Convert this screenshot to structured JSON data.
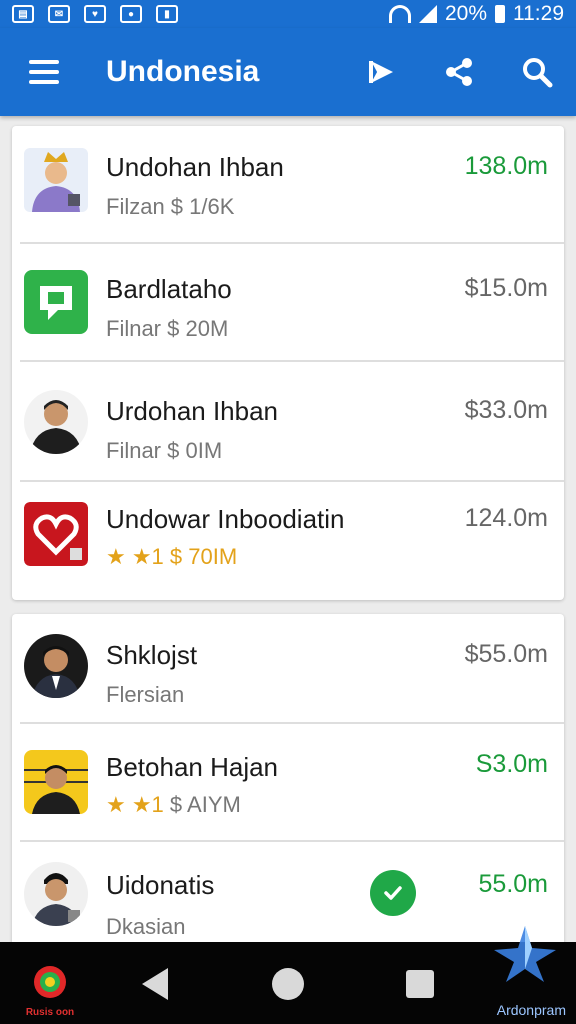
{
  "status_bar": {
    "battery": "20%",
    "time": "11:29"
  },
  "app_bar": {
    "title": "Undonesia"
  },
  "groups": [
    {
      "rows": [
        {
          "title": "Undohan Ihban",
          "subtitle": "Filzan $ 1/6K",
          "amount": "138.0m",
          "amount_color": "#1a9a3a",
          "avatar": "crowned-man-avatar",
          "stars": ""
        },
        {
          "title": "Bardlataho",
          "subtitle": "Filnar $ 20M",
          "amount": "$15.0m",
          "amount_color": "#666666",
          "avatar": "chat-bubble-app-icon",
          "stars": ""
        },
        {
          "title": "Urdohan Ihban",
          "subtitle": "Filnar $ 0IM",
          "amount": "$33.0m",
          "amount_color": "#666666",
          "avatar": "man-portrait-avatar",
          "stars": ""
        },
        {
          "title": "Undowar Inboodiatin",
          "subtitle": "$ 70IM",
          "amount": "124.0m",
          "amount_color": "#666666",
          "avatar": "heart-app-icon",
          "stars": "★ ★1"
        }
      ]
    },
    {
      "rows": [
        {
          "title": "Shklojst",
          "subtitle": "Flersian",
          "amount": "$55.0m",
          "amount_color": "#666666",
          "avatar": "man-portrait-avatar",
          "stars": ""
        },
        {
          "title": "Betohan Hajan",
          "subtitle": "$ AIYM",
          "amount": "S3.0m",
          "amount_color": "#1a9a3a",
          "avatar": "man-yellow-avatar",
          "stars": "★ ★1"
        },
        {
          "title": "Uidonatis",
          "subtitle": "Dkasian",
          "amount": "55.0m",
          "amount_color": "#1a9a3a",
          "avatar": "man-cap-avatar",
          "stars": ""
        }
      ]
    }
  ],
  "bottom_brands": {
    "left": "Rusis oon",
    "right": "Ardonpram"
  },
  "colors": {
    "primary": "#1a6fd0",
    "green": "#1a9a3a",
    "gray_amount": "#666666",
    "star": "#e3a21a"
  }
}
